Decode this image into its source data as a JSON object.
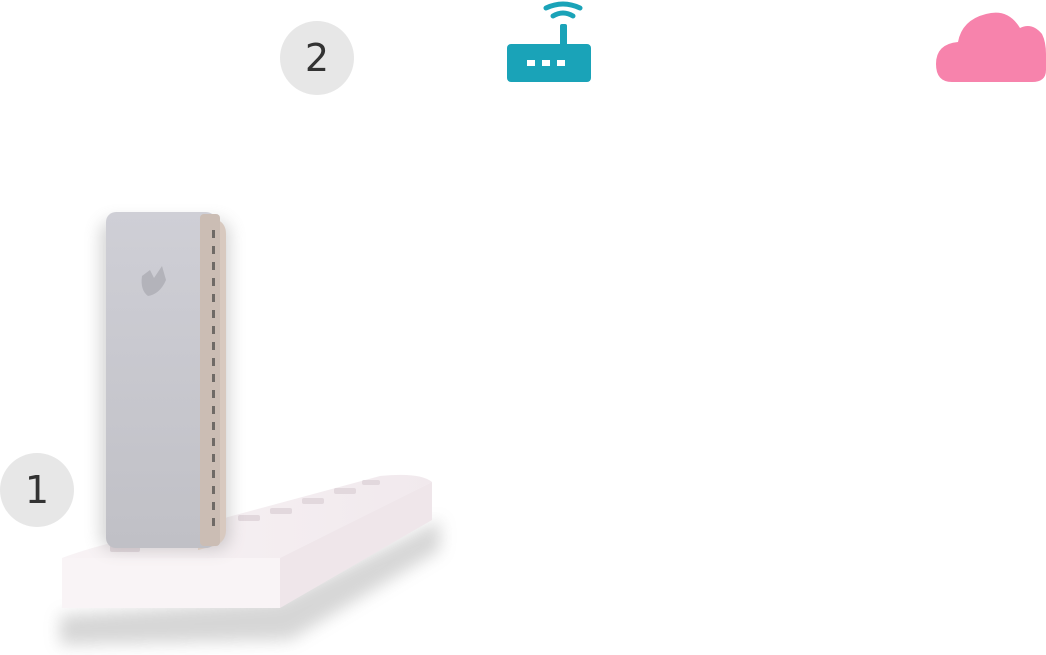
{
  "steps": [
    {
      "number": "1"
    },
    {
      "number": "2"
    }
  ],
  "icons": {
    "router": "router-wifi-icon",
    "cloud": "cloud-icon",
    "device_logo": "bird-logo-icon"
  },
  "colors": {
    "router": "#1aa3b8",
    "cloud": "#f783ac",
    "badge_bg": "#e7e7e7",
    "badge_text": "#333333",
    "device_body": "#c7c7cc",
    "power_strip": "#f6eef1"
  }
}
